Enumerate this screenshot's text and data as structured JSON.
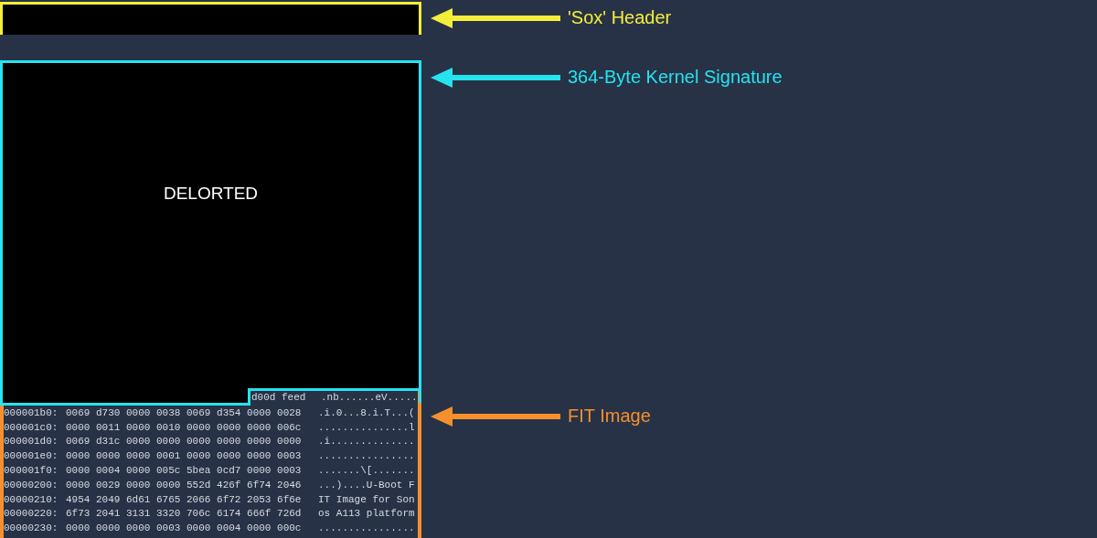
{
  "header_block": {
    "annotation": {
      "label": "'Sox' Header",
      "color": "#f4ee3a"
    }
  },
  "kernel_block": {
    "text": "DELORTED",
    "annotation": {
      "label": "364-Byte Kernel Signature",
      "color": "#25e3ef"
    }
  },
  "fit_block": {
    "annotation": {
      "label": "FIT Image",
      "color": "#f5902c"
    },
    "partial_row": {
      "hex": "d00d feed",
      "ascii": ".nb......eV....."
    },
    "rows": [
      {
        "offset": "000001b0:",
        "hex": "0069 d730 0000 0038 0069 d354 0000 0028",
        "ascii": ".i.0...8.i.T...("
      },
      {
        "offset": "000001c0:",
        "hex": "0000 0011 0000 0010 0000 0000 0000 006c",
        "ascii": "...............l"
      },
      {
        "offset": "000001d0:",
        "hex": "0069 d31c 0000 0000 0000 0000 0000 0000",
        "ascii": ".i.............."
      },
      {
        "offset": "000001e0:",
        "hex": "0000 0000 0000 0001 0000 0000 0000 0003",
        "ascii": "................"
      },
      {
        "offset": "000001f0:",
        "hex": "0000 0004 0000 005c 5bea 0cd7 0000 0003",
        "ascii": ".......\\[......."
      },
      {
        "offset": "00000200:",
        "hex": "0000 0029 0000 0000 552d 426f 6f74 2046",
        "ascii": "...)....U-Boot F"
      },
      {
        "offset": "00000210:",
        "hex": "4954 2049 6d61 6765 2066 6f72 2053 6f6e",
        "ascii": "IT Image for Son"
      },
      {
        "offset": "00000220:",
        "hex": "6f73 2041 3131 3320 706c 6174 666f 726d",
        "ascii": "os A113 platform"
      },
      {
        "offset": "00000230:",
        "hex": "0000 0000 0000 0003 0000 0004 0000 000c",
        "ascii": "................"
      }
    ]
  }
}
